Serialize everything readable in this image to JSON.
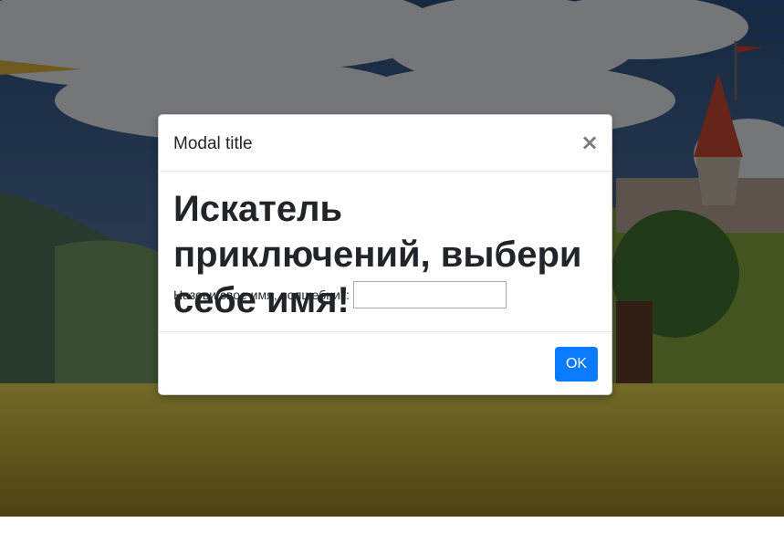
{
  "colors": {
    "sky": "#2f4f7a",
    "cloud": "#c9cfd3",
    "grass": "#b8a23a",
    "hill_dark": "#4f6a55",
    "tower_roof": "#b8442e",
    "primary_button": "#0a7bff"
  },
  "modal": {
    "title": "Modal title",
    "close_glyph": "×",
    "close_icon": "close-icon",
    "heading": "Искатель приключений, выбери себе имя!",
    "name_label": "Назови свое имя, волшебник:",
    "name_value": "",
    "ok_label": "OK"
  }
}
